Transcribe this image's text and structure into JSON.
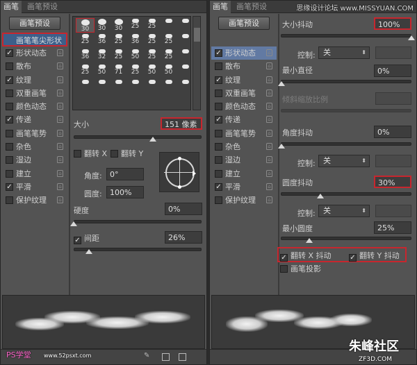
{
  "left": {
    "tabs": [
      "画笔",
      "画笔预设"
    ],
    "preset_btn": "画笔预设",
    "sidebar": {
      "header": "画笔笔尖形状",
      "items": [
        {
          "label": "形状动态",
          "checked": true
        },
        {
          "label": "散布",
          "checked": false
        },
        {
          "label": "纹理",
          "checked": true
        },
        {
          "label": "双重画笔",
          "checked": false
        },
        {
          "label": "颜色动态",
          "checked": false
        },
        {
          "label": "传递",
          "checked": true
        },
        {
          "label": "画笔笔势",
          "checked": false
        },
        {
          "label": "杂色",
          "checked": false
        },
        {
          "label": "湿边",
          "checked": false
        },
        {
          "label": "建立",
          "checked": false
        },
        {
          "label": "平滑",
          "checked": true
        },
        {
          "label": "保护纹理",
          "checked": false
        }
      ]
    },
    "brush_sizes": [
      [
        "30",
        "30",
        "30",
        "25",
        "25",
        "",
        ""
      ],
      [
        "25",
        "36",
        "25",
        "36",
        "25",
        "25",
        ""
      ],
      [
        "36",
        "32",
        "25",
        "50",
        "25",
        "25",
        ""
      ],
      [
        "25",
        "50",
        "71",
        "25",
        "50",
        "50",
        ""
      ],
      [
        "",
        "",
        "",
        "",
        "",
        "",
        ""
      ]
    ],
    "size_label": "大小",
    "size_value": "151 像素",
    "flip_x": "翻转 X",
    "flip_y": "翻转 Y",
    "angle_label": "角度:",
    "angle_value": "0°",
    "roundness_label": "圆度:",
    "roundness_value": "100%",
    "hardness_label": "硬度",
    "hardness_value": "0%",
    "spacing_label": "间距",
    "spacing_value": "26%",
    "spacing_checked": true
  },
  "right": {
    "tabs": [
      "画笔",
      "画笔预设"
    ],
    "preset_btn": "画笔预设",
    "sidebar": {
      "items": [
        {
          "label": "形状动态",
          "checked": true,
          "selected": true
        },
        {
          "label": "散布",
          "checked": false
        },
        {
          "label": "纹理",
          "checked": true
        },
        {
          "label": "双重画笔",
          "checked": false
        },
        {
          "label": "颜色动态",
          "checked": false
        },
        {
          "label": "传递",
          "checked": true
        },
        {
          "label": "画笔笔势",
          "checked": false
        },
        {
          "label": "杂色",
          "checked": false
        },
        {
          "label": "湿边",
          "checked": false
        },
        {
          "label": "建立",
          "checked": false
        },
        {
          "label": "平滑",
          "checked": true
        },
        {
          "label": "保护纹理",
          "checked": false
        }
      ]
    },
    "size_jitter_label": "大小抖动",
    "size_jitter_value": "100%",
    "control_label": "控制:",
    "control1_value": "关",
    "min_diameter_label": "最小直径",
    "min_diameter_value": "0%",
    "tilt_scale_label": "倾斜缩放比例",
    "angle_jitter_label": "角度抖动",
    "angle_jitter_value": "0%",
    "control2_value": "关",
    "roundness_jitter_label": "圆度抖动",
    "roundness_jitter_value": "30%",
    "control3_value": "关",
    "min_roundness_label": "最小圆度",
    "min_roundness_value": "25%",
    "flip_x_jitter": "翻转 X 抖动",
    "flip_y_jitter": "翻转 Y 抖动",
    "brush_projection": "画笔投影"
  },
  "watermarks": {
    "top_right": "思缘设计论坛 www.MISSYUAN.COM",
    "bottom_left": "PS学堂",
    "bottom_left_url": "www.52psxt.com",
    "bottom_right": "朱峰社区",
    "bottom_right_url": "ZF3D.COM"
  }
}
